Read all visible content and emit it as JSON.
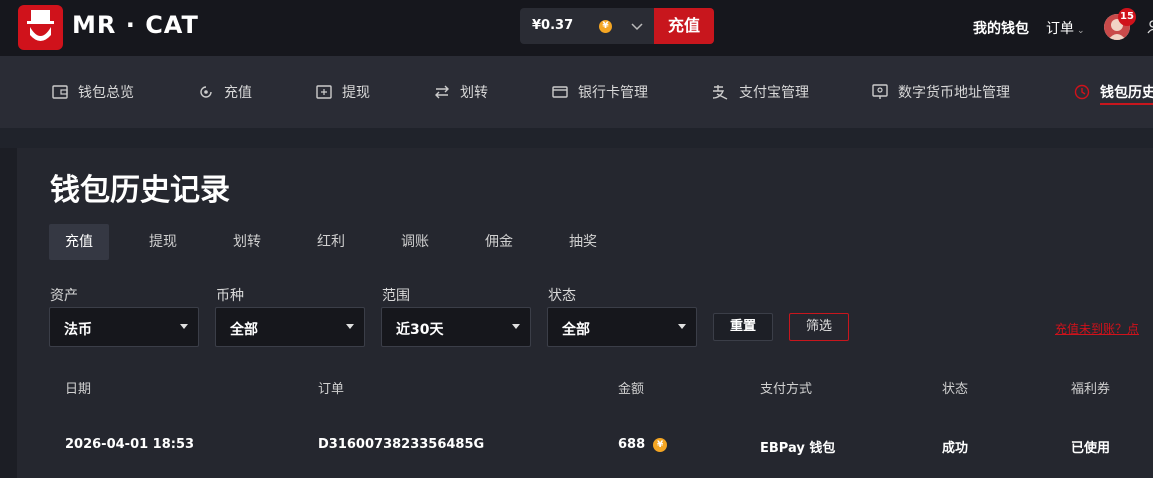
{
  "header": {
    "brand": "MR · CAT",
    "balance": "¥0.37",
    "coin_symbol": "¥",
    "topup_label": "充值",
    "my_wallet": "我的钱包",
    "orders": "订单",
    "notification_count": "15"
  },
  "nav": {
    "items": [
      {
        "label": "钱包总览",
        "icon": "wallet-icon"
      },
      {
        "label": "充值",
        "icon": "recharge-icon"
      },
      {
        "label": "提现",
        "icon": "withdraw-icon"
      },
      {
        "label": "划转",
        "icon": "transfer-icon"
      },
      {
        "label": "银行卡管理",
        "icon": "bank-card-icon"
      },
      {
        "label": "支付宝管理",
        "icon": "alipay-icon"
      },
      {
        "label": "数字货币地址管理",
        "icon": "crypto-address-icon"
      },
      {
        "label": "钱包历史",
        "icon": "history-icon"
      }
    ],
    "active_index": 7
  },
  "page": {
    "title": "钱包历史记录",
    "tabs": [
      "充值",
      "提现",
      "划转",
      "红利",
      "调账",
      "佣金",
      "抽奖"
    ],
    "active_tab": 0
  },
  "filters": {
    "asset_label": "资产",
    "asset_value": "法币",
    "currency_label": "币种",
    "currency_value": "全部",
    "range_label": "范围",
    "range_value": "近30天",
    "status_label": "状态",
    "status_value": "全部",
    "reset_label": "重置",
    "filter_label": "筛选",
    "help_link": "充值未到账？点"
  },
  "table": {
    "headers": [
      "日期",
      "订单",
      "金额",
      "支付方式",
      "状态",
      "福利券"
    ],
    "rows": [
      {
        "date": "2026-04-01 18:53",
        "order": "D3160073823356485G",
        "amount": "688",
        "method": "EBPay 钱包",
        "status": "成功",
        "coupon": "已使用"
      }
    ]
  },
  "colors": {
    "brand_red": "#c8161d",
    "coin": "#f5a623",
    "background": "#1c1e25"
  }
}
